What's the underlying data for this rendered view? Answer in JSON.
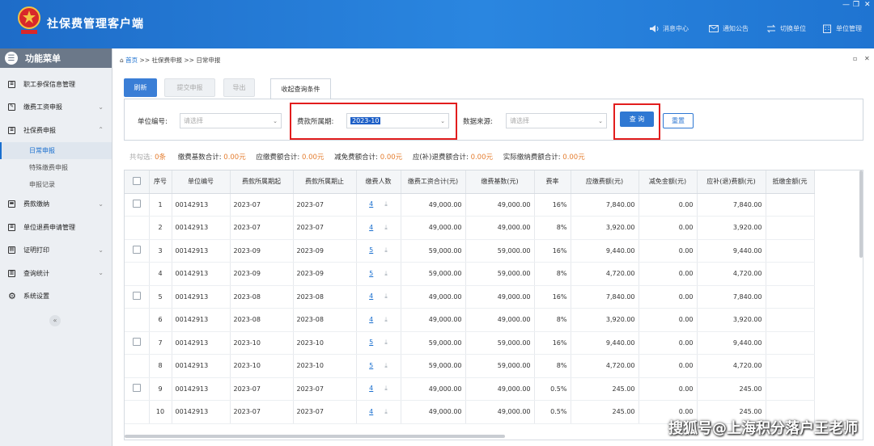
{
  "header": {
    "title": "社保费管理客户端",
    "nav": [
      {
        "label": "消息中心",
        "icon": "speaker-icon"
      },
      {
        "label": "通知公告",
        "icon": "mail-icon"
      },
      {
        "label": "切换单位",
        "icon": "switch-icon"
      },
      {
        "label": "单位管理",
        "icon": "building-icon"
      }
    ]
  },
  "sidebar": {
    "title": "功能菜单",
    "items": [
      {
        "label": "职工参保信息管理"
      },
      {
        "label": "缴费工资申报"
      },
      {
        "label": "社保费申报"
      },
      {
        "label": "费款缴纳"
      },
      {
        "label": "单位退费申请管理"
      },
      {
        "label": "证明打印"
      },
      {
        "label": "查询统计"
      },
      {
        "label": "系统设置"
      }
    ],
    "subitems": [
      "日常申报",
      "特殊缴费申报",
      "申报记录"
    ]
  },
  "breadcrumb": "首页 >> 社保费申报 >> 日常申报",
  "breadcrumb_home": "首页",
  "breadcrumb_rest": ">> 社保费申报 >> 日常申报",
  "toolbar": {
    "refresh": "刷新",
    "submit": "提交申报",
    "export": "导出",
    "tab": "收起查询条件"
  },
  "filters": {
    "unit_code_label": "单位编号:",
    "unit_code_placeholder": "请选择",
    "period_label": "费款所属期:",
    "period_value": "2023-10",
    "source_label": "数据来源:",
    "source_placeholder": "请选择",
    "query": "查 询",
    "reset": "重置"
  },
  "totals": {
    "selected_label": "共勾选:",
    "selected_value": "0条",
    "base_label": "缴费基数合计:",
    "base_value": "0.00元",
    "due_label": "应缴费额合计:",
    "due_value": "0.00元",
    "reduce_label": "减免费额合计:",
    "reduce_value": "0.00元",
    "refund_label": "应(补)退费额合计:",
    "refund_value": "0.00元",
    "actual_label": "实际缴纳费额合计:",
    "actual_value": "0.00元"
  },
  "table": {
    "columns": [
      "序号",
      "单位编号",
      "费款所属期起",
      "费款所属期止",
      "缴费人数",
      "缴费工资合计(元)",
      "缴费基数(元)",
      "费率",
      "应缴费额(元)",
      "减免金额(元)",
      "应补(退)费额(元)",
      "抵缴金额(元"
    ],
    "rows": [
      {
        "no": "1",
        "unit": "00142913",
        "start": "2023-07",
        "end": "2023-07",
        "count": "4",
        "wage": "49,000.00",
        "base": "49,000.00",
        "rate": "16%",
        "due": "7,840.00",
        "reduce": "0.00",
        "refund": "7,840.00"
      },
      {
        "no": "2",
        "unit": "00142913",
        "start": "2023-07",
        "end": "2023-07",
        "count": "4",
        "wage": "49,000.00",
        "base": "49,000.00",
        "rate": "8%",
        "due": "3,920.00",
        "reduce": "0.00",
        "refund": "3,920.00"
      },
      {
        "no": "3",
        "unit": "00142913",
        "start": "2023-09",
        "end": "2023-09",
        "count": "5",
        "wage": "59,000.00",
        "base": "59,000.00",
        "rate": "16%",
        "due": "9,440.00",
        "reduce": "0.00",
        "refund": "9,440.00"
      },
      {
        "no": "4",
        "unit": "00142913",
        "start": "2023-09",
        "end": "2023-09",
        "count": "5",
        "wage": "59,000.00",
        "base": "59,000.00",
        "rate": "8%",
        "due": "4,720.00",
        "reduce": "0.00",
        "refund": "4,720.00"
      },
      {
        "no": "5",
        "unit": "00142913",
        "start": "2023-08",
        "end": "2023-08",
        "count": "4",
        "wage": "49,000.00",
        "base": "49,000.00",
        "rate": "16%",
        "due": "7,840.00",
        "reduce": "0.00",
        "refund": "7,840.00"
      },
      {
        "no": "6",
        "unit": "00142913",
        "start": "2023-08",
        "end": "2023-08",
        "count": "4",
        "wage": "49,000.00",
        "base": "49,000.00",
        "rate": "8%",
        "due": "3,920.00",
        "reduce": "0.00",
        "refund": "3,920.00"
      },
      {
        "no": "7",
        "unit": "00142913",
        "start": "2023-10",
        "end": "2023-10",
        "count": "5",
        "wage": "59,000.00",
        "base": "59,000.00",
        "rate": "16%",
        "due": "9,440.00",
        "reduce": "0.00",
        "refund": "9,440.00"
      },
      {
        "no": "8",
        "unit": "00142913",
        "start": "2023-10",
        "end": "2023-10",
        "count": "5",
        "wage": "59,000.00",
        "base": "59,000.00",
        "rate": "8%",
        "due": "4,720.00",
        "reduce": "0.00",
        "refund": "4,720.00"
      },
      {
        "no": "9",
        "unit": "00142913",
        "start": "2023-07",
        "end": "2023-07",
        "count": "4",
        "wage": "49,000.00",
        "base": "49,000.00",
        "rate": "0.5%",
        "due": "245.00",
        "reduce": "0.00",
        "refund": "245.00"
      },
      {
        "no": "10",
        "unit": "00142913",
        "start": "2023-07",
        "end": "2023-07",
        "count": "4",
        "wage": "49,000.00",
        "base": "49,000.00",
        "rate": "0.5%",
        "due": "245.00",
        "reduce": "0.00",
        "refund": "245.00"
      }
    ]
  },
  "watermark": "搜狐号@上海积分落户王老师"
}
